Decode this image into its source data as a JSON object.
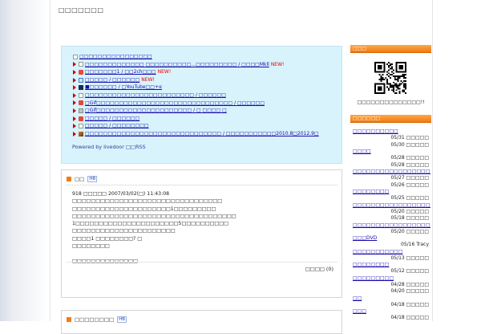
{
  "site": {
    "title": "□□□□□□□"
  },
  "recent": {
    "items": [
      {
        "icon": "page-icon",
        "text": "□□□□□□□□□□□□□□□□",
        "new": ""
      },
      {
        "icon": "page-icon",
        "text": "□□□□□□□□□□□□□ □□□□□□□□□□…□□□□□□□□□ / □□□□Mkll",
        "new": "NEW!"
      },
      {
        "icon": "red-icon",
        "text": "□□□□□□□1 / □□2ch□□□",
        "new": "NEW!"
      },
      {
        "icon": "check-icon",
        "text": "□□□□□ / □□□□□□",
        "new": "NEW!"
      },
      {
        "icon": "dark-icon",
        "text": "■□□□□□□ / □YouTube□□+α",
        "new": ""
      },
      {
        "icon": "page-icon",
        "text": "□□□□□□□□□□□□□□□□□□□□□□□□ / □□□□□□",
        "new": ""
      },
      {
        "icon": "red-icon",
        "text": "□Gif□□□□□□□□□□□□□□□□□□□□□□□□□□□□□□ / □□□□□□",
        "new": ""
      },
      {
        "icon": "gray-icon",
        "text": "□Gif□□□□□□□□□□□□□□□□□□□□□ / □ □□□□ □",
        "new": ""
      },
      {
        "icon": "red-icon",
        "text": "□□□□□ / □□□□□□",
        "new": ""
      },
      {
        "icon": "page-icon",
        "text": "□□□□□ / □□□□□□□□",
        "new": ""
      },
      {
        "icon": "photo-icon",
        "text": "□□□□□□□□□□□□□□□□□□□□□□□□□□□□□□ / □□□□□□□□□□□2010.8□2012.9□",
        "new": ""
      }
    ],
    "powered": "Powered by livedoor □□RSS"
  },
  "post": {
    "title": "□□",
    "hatebu": "HB",
    "body": [
      "918 □□□□□ 2007/03/02(□) 11:43:08",
      "□□□□□□□□□□□□□□□□□□□□□□□□□□□□□□□□",
      "□□□□□□□□□□□□□□□□□□□□□1□□□□□□□□□",
      "□□□□□□□□□□□□□□□□□□□□□□□□□□□□□□□□□□□",
      "1□□□□□□□□□□□□□□□□□□□□□□5□□□□□□□□□□",
      "□□□□□□□□□□□□□□□□□□□□□□",
      "□□□□1 □□□□□□□□? □",
      "□□□□□□□□",
      "",
      "□□□□□□□□□□□□□□"
    ],
    "comment_label": "□□□□ (0)"
  },
  "post2": {
    "title": "□□□□□□□□",
    "hatebu": "HB"
  },
  "sidebar": {
    "qr_header": "□□□",
    "qr_caption": "□□□□□□□□□□□□□□!!",
    "comments_header": "□□□□□□",
    "comments": [
      {
        "title": "□□□□□□□□□□",
        "meta": [
          "05/31 □□□□□",
          "05/30 □□□□□"
        ]
      },
      {
        "title": "□□□□",
        "meta": [
          "05/28 □□□□□",
          "05/28 □□□□□"
        ]
      },
      {
        "title": "□□□□□□□□□□□□□□□□□□□□□",
        "meta": [
          "05/27 □□□□□",
          "05/26 □□□□□"
        ]
      },
      {
        "title": "□□□□□□□□",
        "meta": [
          "05/25 □□□□□"
        ]
      },
      {
        "title": "□□□□□□□□□□□□□□□□□□□□□□□",
        "meta": [
          "05/20 □□□□□",
          "05/18 □□□□□"
        ]
      },
      {
        "title": "□□□□□□□□□□□□□□□□□□□□□□□□",
        "meta": [
          "05/20 □□□□□"
        ]
      },
      {
        "title": "□□□DVD",
        "meta": [
          "05/16 Tracy"
        ]
      },
      {
        "title": "□□□□□□□□□□□",
        "meta": [
          "05/13 □□□□□"
        ]
      },
      {
        "title": "□□□□□□□□",
        "meta": [
          "05/12 □□□□□"
        ]
      },
      {
        "title": "□□□□□□□□□",
        "meta": [
          "04/28 □□□□□",
          "04/20 □□□□□"
        ]
      },
      {
        "title": "□□",
        "meta": [
          "04/18 □□□□□"
        ]
      },
      {
        "title": "□□□",
        "meta": [
          "04/18 □□□□□"
        ]
      }
    ]
  }
}
